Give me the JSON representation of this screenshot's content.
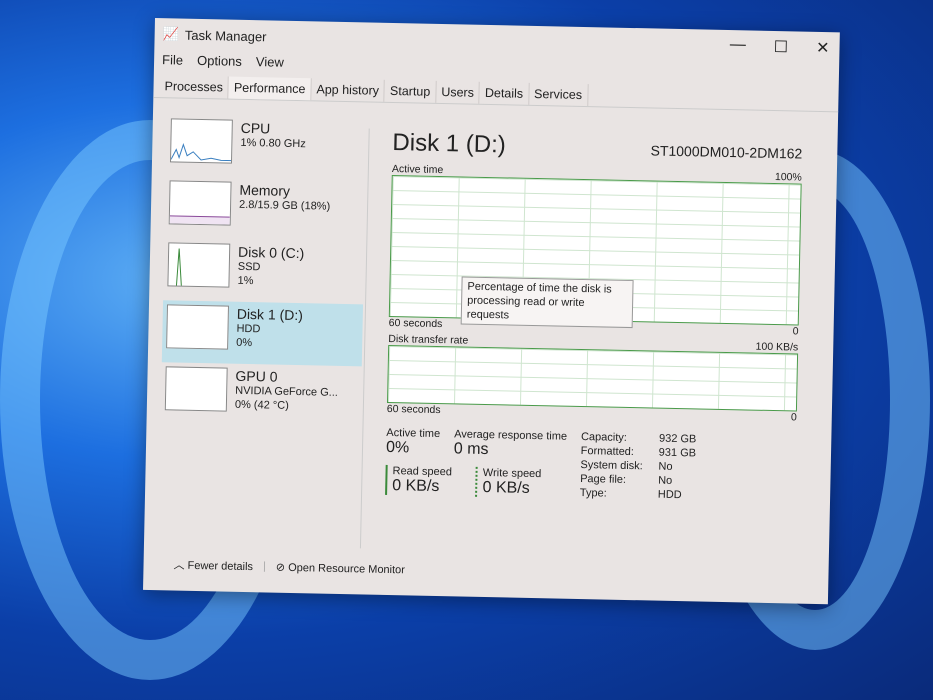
{
  "window": {
    "title": "Task Manager",
    "menu": [
      "File",
      "Options",
      "View"
    ],
    "tabs": [
      "Processes",
      "Performance",
      "App history",
      "Startup",
      "Users",
      "Details",
      "Services"
    ],
    "active_tab": "Performance"
  },
  "sidebar": [
    {
      "name": "CPU",
      "l1": "1% 0.80 GHz",
      "l2": ""
    },
    {
      "name": "Memory",
      "l1": "2.8/15.9 GB (18%)",
      "l2": ""
    },
    {
      "name": "Disk 0 (C:)",
      "l1": "SSD",
      "l2": "1%"
    },
    {
      "name": "Disk 1 (D:)",
      "l1": "HDD",
      "l2": "0%"
    },
    {
      "name": "GPU 0",
      "l1": "NVIDIA GeForce G...",
      "l2": "0% (42 °C)"
    }
  ],
  "main": {
    "title": "Disk 1 (D:)",
    "model": "ST1000DM010-2DM162",
    "g1": {
      "label": "Active time",
      "max": "100%",
      "xl": "60 seconds",
      "xr": "0"
    },
    "tooltip": "Percentage of time the disk is processing read or write requests",
    "g2": {
      "label": "Disk transfer rate",
      "max": "100 KB/s",
      "xl": "60 seconds",
      "xr": "0"
    },
    "active_label": "Active time",
    "active": "0%",
    "resp_label": "Average response time",
    "resp": "0 ms",
    "read_label": "Read speed",
    "read": "0 KB/s",
    "write_label": "Write speed",
    "write": "0 KB/s",
    "props": [
      [
        "Capacity:",
        "932 GB"
      ],
      [
        "Formatted:",
        "931 GB"
      ],
      [
        "System disk:",
        "No"
      ],
      [
        "Page file:",
        "No"
      ],
      [
        "Type:",
        "HDD"
      ]
    ]
  },
  "footer": {
    "fewer": "Fewer details",
    "monitor": "Open Resource Monitor"
  }
}
